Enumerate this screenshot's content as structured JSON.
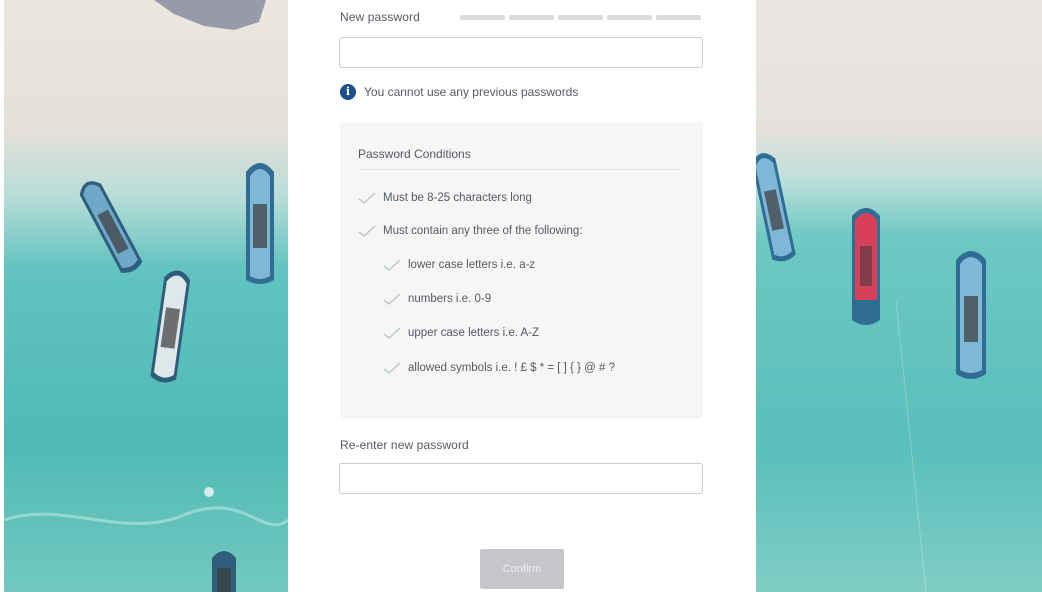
{
  "form": {
    "new_password": {
      "label": "New password",
      "value": "",
      "placeholder": "",
      "strength_segments": 5,
      "strength_filled": 0
    },
    "info": {
      "icon": "info-icon",
      "icon_glyph": "i",
      "text": "You cannot use any previous passwords"
    },
    "conditions": {
      "title": "Password Conditions",
      "items": [
        {
          "text": "Must be 8-25 characters long",
          "met": false
        },
        {
          "text": "Must contain any three of the following:",
          "met": false
        },
        {
          "text": "lower case letters i.e. a-z",
          "met": false
        },
        {
          "text": "numbers i.e. 0-9",
          "met": false
        },
        {
          "text": "upper case letters i.e. A-Z",
          "met": false
        },
        {
          "text": "allowed symbols i.e. ! £ $ * = [ ] { } @ # ?",
          "met": false
        }
      ]
    },
    "reenter_password": {
      "label": "Re-enter new password",
      "value": "",
      "placeholder": ""
    },
    "confirm_label": "Confirm"
  },
  "colors": {
    "info_icon": "#1f4f8a",
    "strength_empty": "#d8dbde",
    "check": "#b9c7b9",
    "button_disabled": "#c4c6c9"
  }
}
